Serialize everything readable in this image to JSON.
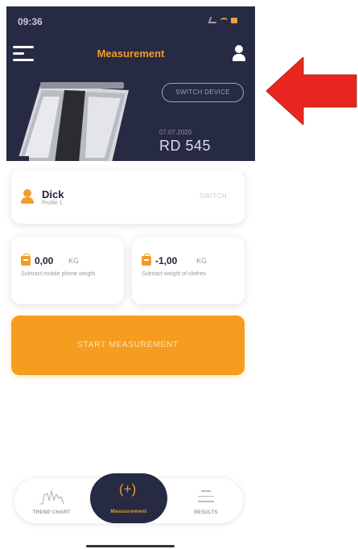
{
  "status_bar": {
    "time": "09:36"
  },
  "header": {
    "title": "Measurement",
    "switch_device_label": "SWITCH DEVICE",
    "device_date": "07.07.2020",
    "device_model": "RD 545"
  },
  "user": {
    "name": "Dick",
    "profile": "Profile 1",
    "switch_label": "SWITCH"
  },
  "weights": [
    {
      "value": "0,00",
      "unit": "KG",
      "description": "Subtract mobile phone weight"
    },
    {
      "value": "-1,00",
      "unit": "KG",
      "description": "Subtract weight of clothes"
    }
  ],
  "start_button_label": "START MEASUREMENT",
  "nav": {
    "items": [
      {
        "label": "TREND CHART",
        "icon": "trend-chart-icon"
      },
      {
        "label": "Measurement",
        "icon": "measure-plus-icon",
        "icon_text": "(+)"
      },
      {
        "label": "RESULTS",
        "icon": "results-list-icon"
      }
    ]
  },
  "colors": {
    "header_bg": "#262a43",
    "accent": "#f39c2a",
    "start_button": "#f59d1f",
    "annotation_arrow": "#e8261f"
  }
}
